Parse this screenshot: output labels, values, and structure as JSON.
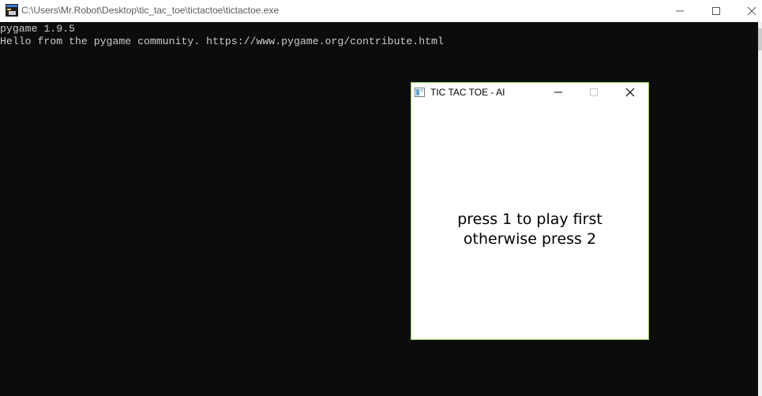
{
  "console": {
    "title": "C:\\Users\\Mr.Robot\\Desktop\\tic_tac_toe\\tictactoe\\tictactoe.exe",
    "lines": [
      "pygame 1.9.5",
      "Hello from the pygame community. https://www.pygame.org/contribute.html"
    ],
    "background": "#0c0c0c",
    "text_color": "#cccccc"
  },
  "game_window": {
    "title": "TIC TAC TOE - AI",
    "prompt_lines": [
      "press 1 to play first",
      "otherwise press 2"
    ],
    "border_color": "#8fd14f"
  },
  "icons": {
    "console_app": "console-app-icon",
    "game_app": "pygame-window-icon",
    "minimize": "minimize-icon",
    "maximize": "maximize-icon",
    "close": "close-icon"
  }
}
